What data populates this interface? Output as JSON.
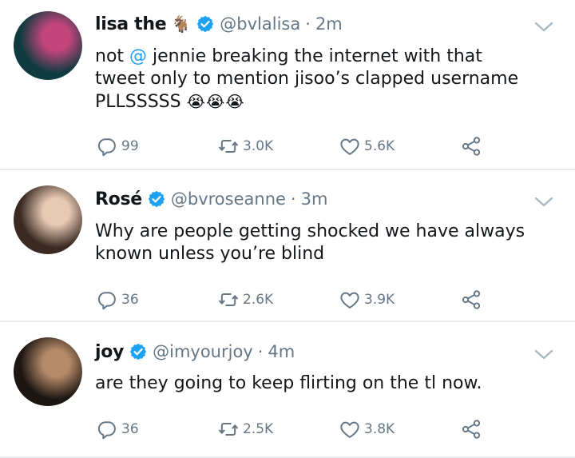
{
  "tweets": [
    {
      "name": "lisa the",
      "name_emoji": "🐐",
      "handle": "@bvlalisa",
      "separator": "·",
      "time": "2m",
      "text_lines": [
        {
          "parts": [
            {
              "t": "not "
            },
            {
              "t": "@",
              "mention": true
            },
            {
              "t": " jennie breaking the internet with that"
            }
          ]
        },
        {
          "parts": [
            {
              "t": "tweet only to mention jisoo’s clapped username"
            }
          ]
        },
        {
          "parts": [
            {
              "t": "PLLSSSSS "
            },
            {
              "t": "😭😭😭",
              "emoji": true
            }
          ]
        }
      ],
      "replies": "99",
      "retweets": "3.0K",
      "likes": "5.6K",
      "avatar_colors": [
        "#0d3b3f",
        "#c4457c"
      ]
    },
    {
      "name": "Rosé",
      "name_emoji": "",
      "handle": "@bvroseanne",
      "separator": "·",
      "time": "3m",
      "text_lines": [
        {
          "parts": [
            {
              "t": "Why are people getting shocked we have always"
            }
          ]
        },
        {
          "parts": [
            {
              "t": "known unless you’re blind"
            }
          ]
        }
      ],
      "replies": "36",
      "retweets": "2.6K",
      "likes": "3.9K",
      "avatar_colors": [
        "#3a2a22",
        "#e8c9b4"
      ]
    },
    {
      "name": "joy",
      "name_emoji": "",
      "handle": "@imyourjoy",
      "separator": "·",
      "time": "4m",
      "text_lines": [
        {
          "parts": [
            {
              "t": "are they going to keep flirting on the tl now."
            }
          ]
        }
      ],
      "replies": "36",
      "retweets": "2.5K",
      "likes": "3.8K",
      "avatar_colors": [
        "#1c1512",
        "#b58a68"
      ]
    }
  ],
  "colors": {
    "verified": "#1da1f2",
    "secondary": "#657786",
    "divider": "#e6ecf0"
  },
  "icons": {
    "verified": "verified-badge-icon",
    "caret": "chevron-down-icon",
    "reply": "reply-icon",
    "retweet": "retweet-icon",
    "like": "heart-icon",
    "share": "share-icon"
  }
}
